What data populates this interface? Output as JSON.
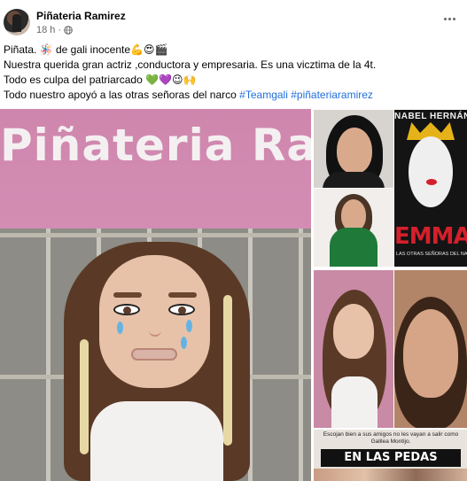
{
  "post": {
    "page_name": "Piñateria Ramirez",
    "timestamp": "18 h",
    "separator": "·",
    "audience_icon": "globe-icon",
    "more_icon": "more-dots-icon",
    "text_lines": [
      "Piñata. 🪅 de gali inocente💪😍🎬",
      "Nuestra querida gran actriz ,conductora y empresaria. Es una vicztima de la 4t.",
      "Todo es culpa del patriarcado 💚💜😉🙌",
      "Todo nuestro apoyó a las otras señoras del narco"
    ],
    "hashtags": [
      "#Teamgali",
      "#piñateriaramirez"
    ]
  },
  "media": {
    "main_photo": {
      "sign_text": "Piñateria Ra"
    },
    "poster": {
      "name": "NABEL HERNÁNDEZ",
      "title": "EMMA",
      "subtitle": "LAS OTRAS SEÑORAS DEL NARCO"
    },
    "meme": {
      "caption": "Escojan bien a sus amigos no les vayan a salir como Galilea Montijo.",
      "banner": "EN LAS PEDAS"
    }
  },
  "colors": {
    "hashtag": "#216fdb",
    "meta": "#65676b",
    "wall_pink": "#d48fb5",
    "poster_red": "#d4202b"
  }
}
